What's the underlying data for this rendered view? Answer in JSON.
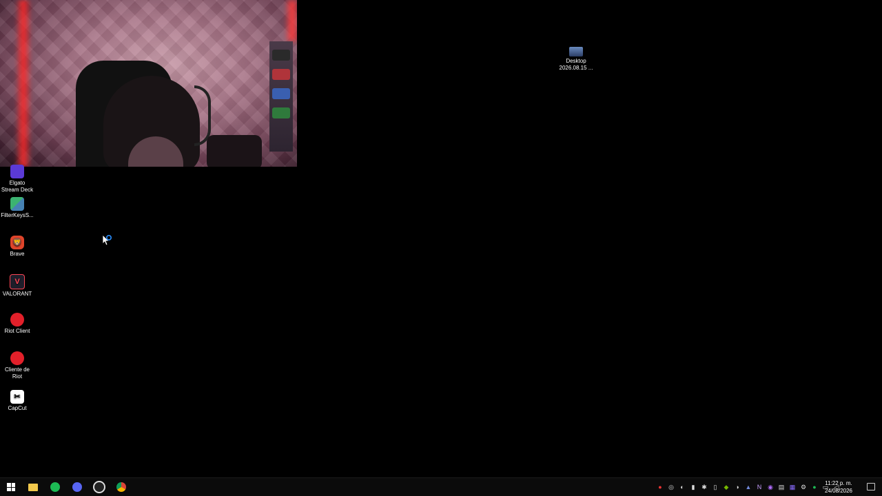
{
  "desktop": {
    "icons": [
      {
        "label": "Elgato Stream Deck",
        "icon": "elgato-stream-deck-icon"
      },
      {
        "label": "FilterKeysS...",
        "icon": "filterkeys-icon"
      },
      {
        "label": "Brave",
        "icon": "brave-icon"
      },
      {
        "label": "VALORANT",
        "icon": "valorant-icon"
      },
      {
        "label": "Riot Client",
        "icon": "riot-client-icon"
      },
      {
        "label": "Cliente de Riot",
        "icon": "riot-client-icon"
      },
      {
        "label": "CapCut",
        "icon": "capcut-icon"
      }
    ],
    "right_icon": {
      "line1": "Desktop",
      "line2": "2026.08.15 ...",
      "icon": "screenshot-icon"
    }
  },
  "taskbar": {
    "pinned": [
      "start-icon",
      "file-explorer-icon",
      "spotify-icon",
      "discord-icon",
      "obs-icon",
      "chrome-icon"
    ],
    "tray_icons": [
      "mic-muted-icon",
      "tray-icon",
      "tray-icon",
      "microphone-icon",
      "tray-icon",
      "tray-icon",
      "nvidia-icon",
      "steam-icon",
      "tray-icon",
      "tray-icon",
      "tray-icon",
      "tray-icon",
      "tray-icon",
      "spotify-icon",
      "tray-icon",
      "network-icon",
      "volume-icon"
    ],
    "clock": {
      "time": "11:22 p. m.",
      "date": "24/08/2026"
    }
  },
  "colors": {
    "taskbar_bg": "#0b0b0b",
    "desktop_bg": "#000000"
  }
}
